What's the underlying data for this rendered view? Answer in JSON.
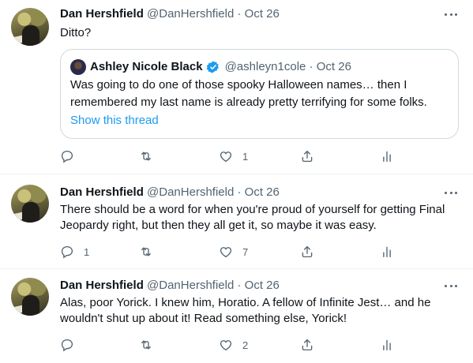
{
  "tweets": [
    {
      "name": "Dan Hershfield",
      "handle": "@DanHershfield",
      "dot": "·",
      "date": "Oct 26",
      "text": "Ditto?",
      "quote": {
        "name": "Ashley Nicole Black",
        "handle": "@ashleyn1cole",
        "dot": "·",
        "date": "Oct 26",
        "text": "Was going to do one of those spooky Halloween names… then I remembered my last name is already pretty terrifying for some folks.",
        "show_thread": "Show this thread"
      },
      "replies": "",
      "retweets": "",
      "likes": "1"
    },
    {
      "name": "Dan Hershfield",
      "handle": "@DanHershfield",
      "dot": "·",
      "date": "Oct 26",
      "text": "There should be a word for when you're proud of yourself for getting Final Jeopardy right, but then they all get it, so maybe it was easy.",
      "replies": "1",
      "retweets": "",
      "likes": "7"
    },
    {
      "name": "Dan Hershfield",
      "handle": "@DanHershfield",
      "dot": "·",
      "date": "Oct 26",
      "text": "Alas, poor Yorick. I knew him, Horatio. A fellow of Infinite Jest… and he wouldn't shut up about it! Read something else, Yorick!",
      "replies": "",
      "retweets": "",
      "likes": "2"
    }
  ],
  "colors": {
    "text": "#0f1419",
    "secondary": "#536471",
    "link": "#1d9bf0",
    "border": "#cfd9de",
    "divider": "#eff3f4",
    "verified": "#1d9bf0"
  },
  "icons": [
    "reply-icon",
    "retweet-icon",
    "like-icon",
    "share-icon",
    "analytics-icon",
    "more-icon",
    "verified-icon"
  ]
}
